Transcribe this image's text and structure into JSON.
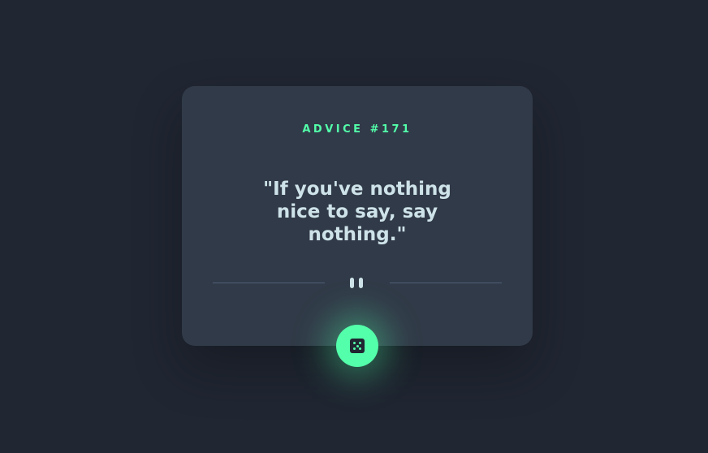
{
  "card": {
    "label": "ADVICE #171",
    "quote": "\"If you've nothing nice to say, say nothing.\""
  },
  "colors": {
    "background": "#202632",
    "card": "#313a48",
    "accent": "#53ffaa",
    "text": "#cee3e9",
    "divider": "#4f5d74"
  },
  "icons": {
    "divider": "pause-icon",
    "button": "dice-icon"
  }
}
